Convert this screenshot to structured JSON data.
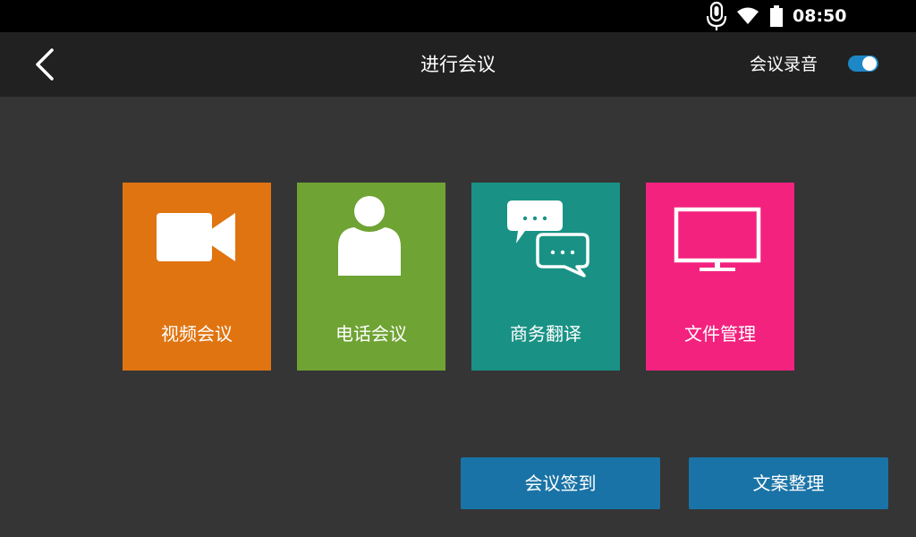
{
  "status_bar": {
    "time": "08:50",
    "icons": [
      "mic-icon",
      "wifi-icon",
      "battery-icon"
    ]
  },
  "title_bar": {
    "back_icon": "chevron-left-icon",
    "title": "进行会议",
    "record_label": "会议录音",
    "record_toggle_on": true
  },
  "tiles": [
    {
      "label": "视频会议",
      "icon": "video-camera-icon",
      "color": "#e07411"
    },
    {
      "label": "电话会议",
      "icon": "person-icon",
      "color": "#6fa334"
    },
    {
      "label": "商务翻译",
      "icon": "chat-bubbles-icon",
      "color": "#199285"
    },
    {
      "label": "文件管理",
      "icon": "monitor-icon",
      "color": "#f3227f"
    }
  ],
  "actions": [
    {
      "label": "会议签到"
    },
    {
      "label": "文案整理"
    }
  ],
  "colors": {
    "button": "#1a73a6",
    "toggle": "#1e88c7",
    "background": "#353535"
  }
}
